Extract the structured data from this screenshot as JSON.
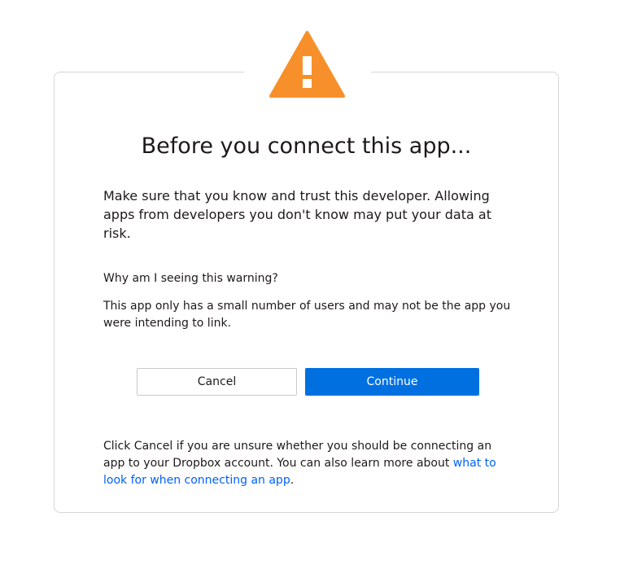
{
  "dialog": {
    "title": "Before you connect this app...",
    "lead": "Make sure that you know and trust this developer. Allowing apps from developers you don't know may put your data at risk.",
    "why_heading": "Why am I seeing this warning?",
    "why_body": "This app only has a small number of users and may not be the app you were intending to link.",
    "cancel_label": "Cancel",
    "continue_label": "Continue",
    "footer_text": "Click Cancel if you are unsure whether you should be connecting an app to your Dropbox account. You can also learn more about ",
    "footer_link": "what to look for when connecting an app",
    "footer_end": "."
  },
  "icons": {
    "warning": "warning-triangle-icon"
  },
  "colors": {
    "warning": "#f7902a",
    "primary": "#0070e0",
    "link": "#0061fe"
  }
}
